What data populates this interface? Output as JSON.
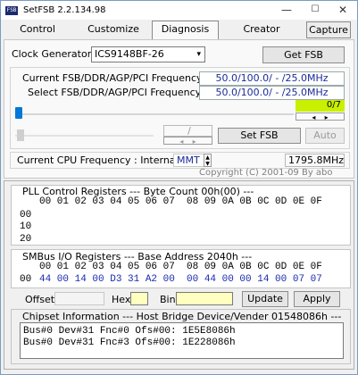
{
  "window": {
    "title": "SetFSB 2.2.134.98",
    "icon_text": "FSB",
    "minimize": "—",
    "maximize": "☐",
    "close": "✕"
  },
  "tabs": [
    "Control",
    "Customize",
    "Diagnosis",
    "Creator",
    "Capture"
  ],
  "clock": {
    "label": "Clock Generator",
    "value": "ICS9148BF-26",
    "get_fsb": "Get FSB"
  },
  "freq": {
    "current_label": "Current FSB/DDR/AGP/PCI Frequency",
    "current_value": "50.0/100.0/ - /25.0MHz",
    "select_label": "Select FSB/DDR/AGP/PCI Frequency",
    "select_value": "50.0/100.0/ - /25.0MHz",
    "slider_level": 0,
    "counter": "0/7",
    "counter_color": "#c8f000",
    "divider": "/",
    "set_fsb": "Set FSB",
    "auto": "Auto"
  },
  "cpu": {
    "label": "Current CPU Frequency : Internal",
    "mode": "MMT",
    "value": "1795.8MHz"
  },
  "copyright": "Copyright (C) 2001-09 By abo",
  "pll": {
    "header": "PLL Control Registers  --- Byte Count 00h(00) ---",
    "columns": "00 01 02 03 04 05 06 07  08 09 0A 0B 0C 0D 0E 0F",
    "rows": [
      "00",
      "10",
      "20"
    ]
  },
  "smbus": {
    "header": "SMBus I/O Registers  --- Base Address 2040h ---",
    "columns": "00 01 02 03 04 05 06 07  08 09 0A 0B 0C 0D 0E 0F",
    "row_label": "00",
    "row_values": "44 00 14 00 D3 31 A2 00  00 44 00 00 14 00 07 07",
    "row_color": "#1a2ab0"
  },
  "controls": {
    "offset": "Offset",
    "hex": "Hex",
    "bin": "Bin",
    "update": "Update",
    "apply": "Apply"
  },
  "chipset": {
    "header": "Chipset Information  --- Host Bridge Device/Vender 01548086h ---",
    "lines": [
      "Bus#0 Dev#31 Fnc#0 Ofs#00: 1E5E8086h",
      "Bus#0 Dev#31 Fnc#3 Ofs#00: 1E228086h"
    ]
  }
}
